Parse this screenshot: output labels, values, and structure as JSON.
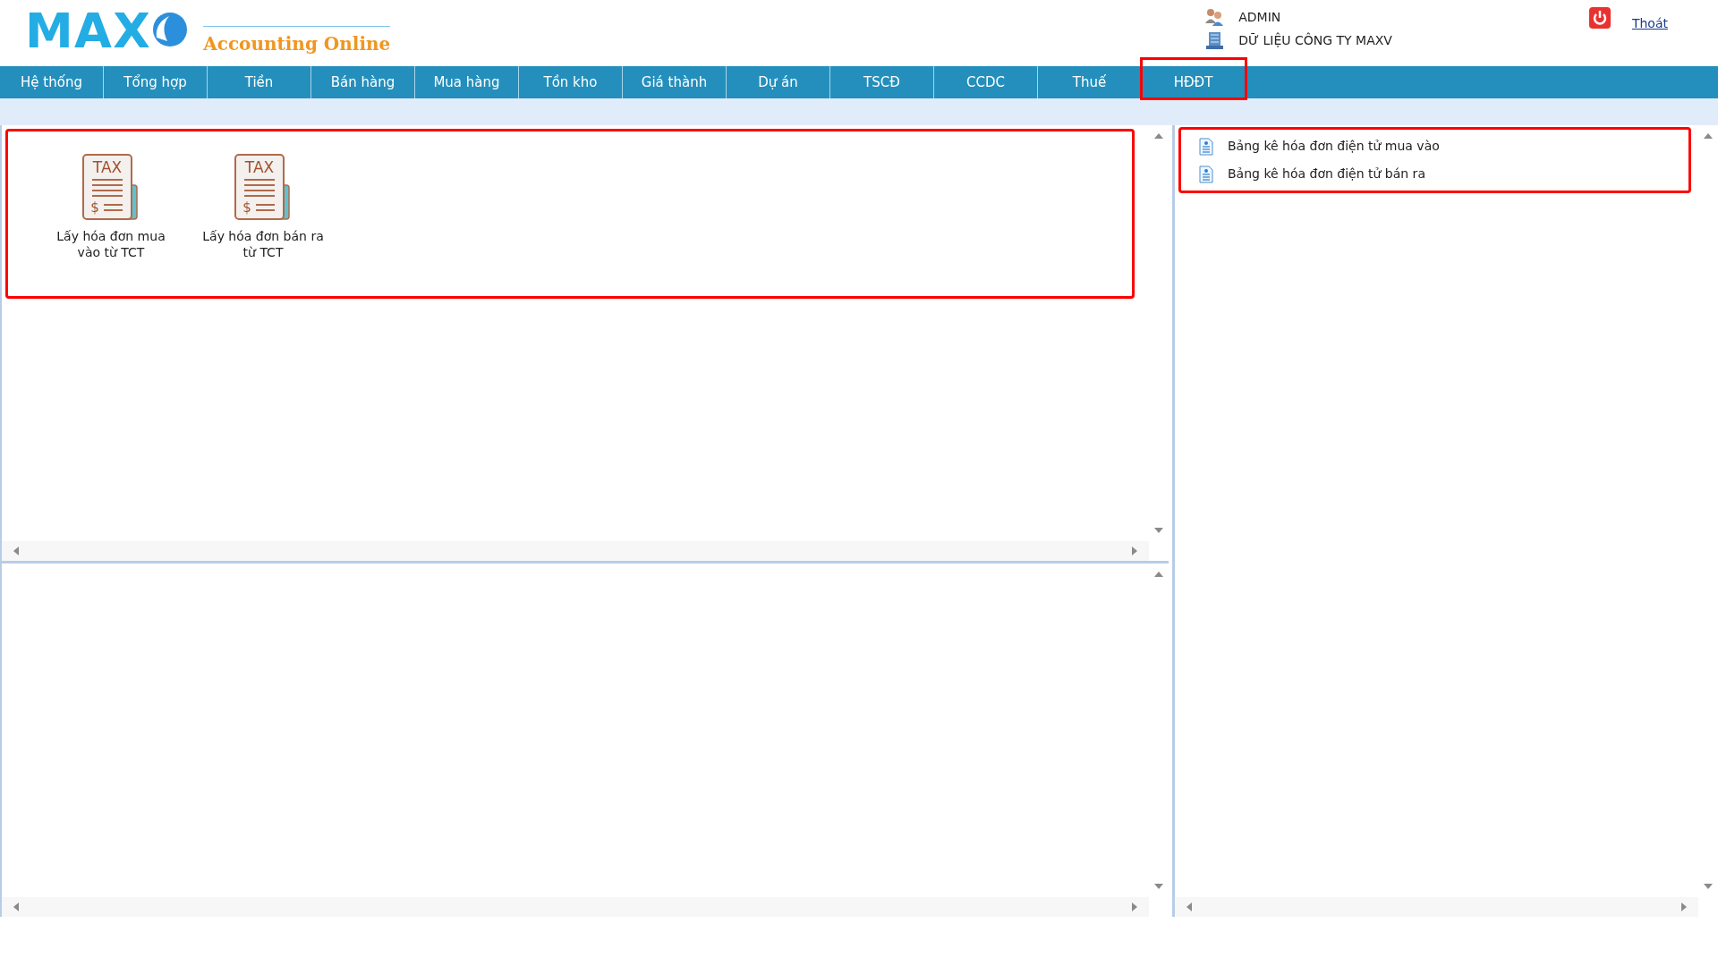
{
  "logo": {
    "mark": "MAX",
    "tagline": "Accounting Online"
  },
  "user": {
    "name": "ADMIN",
    "company": "DỮ LIỆU CÔNG TY MAXV"
  },
  "logout": {
    "label": "Thoát"
  },
  "menu": [
    {
      "label": "Hệ thống",
      "highlighted": false
    },
    {
      "label": "Tổng hợp",
      "highlighted": false
    },
    {
      "label": "Tiền",
      "highlighted": false
    },
    {
      "label": "Bán hàng",
      "highlighted": false
    },
    {
      "label": "Mua hàng",
      "highlighted": false
    },
    {
      "label": "Tồn kho",
      "highlighted": false
    },
    {
      "label": "Giá thành",
      "highlighted": false
    },
    {
      "label": "Dự án",
      "highlighted": false
    },
    {
      "label": "TSCĐ",
      "highlighted": false
    },
    {
      "label": "CCDC",
      "highlighted": false
    },
    {
      "label": "Thuế",
      "highlighted": false
    },
    {
      "label": "HĐĐT",
      "highlighted": true
    }
  ],
  "shortcuts": {
    "highlighted": true,
    "items": [
      {
        "label": "Lấy hóa đơn mua vào từ TCT",
        "icon_title": "TAX",
        "icon_symbol": "$"
      },
      {
        "label": "Lấy hóa đơn bán ra từ TCT",
        "icon_title": "TAX",
        "icon_symbol": "$"
      }
    ]
  },
  "reports": {
    "highlighted": true,
    "items": [
      {
        "label": "Bảng kê hóa đơn điện tử mua vào"
      },
      {
        "label": "Bảng kê hóa đơn điện tử bán ra"
      }
    ]
  }
}
